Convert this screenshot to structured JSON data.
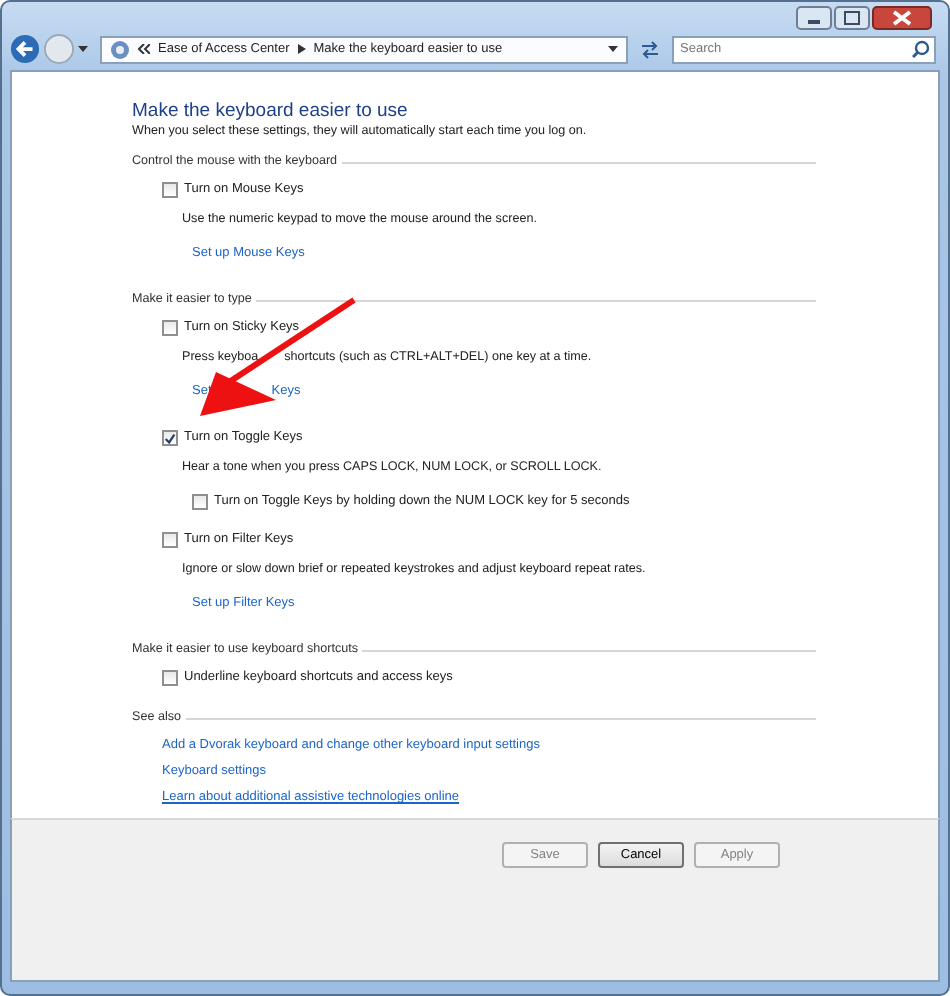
{
  "address": {
    "crumbs": [
      "Ease of Access Center",
      "Make the keyboard easier to use"
    ]
  },
  "search": {
    "placeholder": "Search"
  },
  "heading": "Make the keyboard easier to use",
  "subtitle": "When you select these settings, they will automatically start each time you log on.",
  "sections": [
    {
      "title": "Control the mouse with the keyboard",
      "items": [
        {
          "kind": "checkbox",
          "label": "Turn on Mouse Keys",
          "checked": false
        },
        {
          "kind": "description",
          "text": "Use the numeric keypad to move the mouse around the screen."
        },
        {
          "kind": "link",
          "text": "Set up Mouse Keys"
        }
      ]
    },
    {
      "title": "Make it easier to type",
      "items": [
        {
          "kind": "checkbox",
          "label": "Turn on Sticky Keys",
          "checked": false
        },
        {
          "kind": "description",
          "parts": [
            "Press keyboa",
            "shortcuts (such as CTRL+ALT+DEL) one key at a time."
          ]
        },
        {
          "kind": "link",
          "parts": [
            "Set",
            "Keys"
          ]
        },
        {
          "kind": "checkbox",
          "label": "Turn on Toggle Keys",
          "checked": true
        },
        {
          "kind": "description",
          "text": "Hear a tone when you press CAPS LOCK, NUM LOCK, or SCROLL LOCK."
        },
        {
          "kind": "subcheckbox",
          "label": "Turn on Toggle Keys by holding down the NUM LOCK key for 5 seconds",
          "checked": false
        },
        {
          "kind": "checkbox",
          "label": "Turn on Filter Keys",
          "checked": false
        },
        {
          "kind": "description",
          "text": "Ignore or slow down brief or repeated keystrokes and adjust keyboard repeat rates."
        },
        {
          "kind": "link",
          "text": "Set up Filter Keys"
        }
      ]
    },
    {
      "title": "Make it easier to use keyboard shortcuts",
      "items": [
        {
          "kind": "checkbox",
          "label": "Underline keyboard shortcuts and access keys",
          "checked": false
        }
      ]
    },
    {
      "title": "See also",
      "items": [
        {
          "kind": "seealso",
          "text": "Add a Dvorak keyboard and change other keyboard input settings",
          "underlined": false
        },
        {
          "kind": "seealso",
          "text": "Keyboard settings",
          "underlined": false
        },
        {
          "kind": "seealso",
          "text": "Learn about additional assistive technologies online",
          "underlined": true
        }
      ]
    }
  ],
  "buttons": [
    {
      "label": "Save",
      "disabled": true
    },
    {
      "label": "Cancel",
      "disabled": false
    },
    {
      "label": "Apply",
      "disabled": true
    }
  ]
}
